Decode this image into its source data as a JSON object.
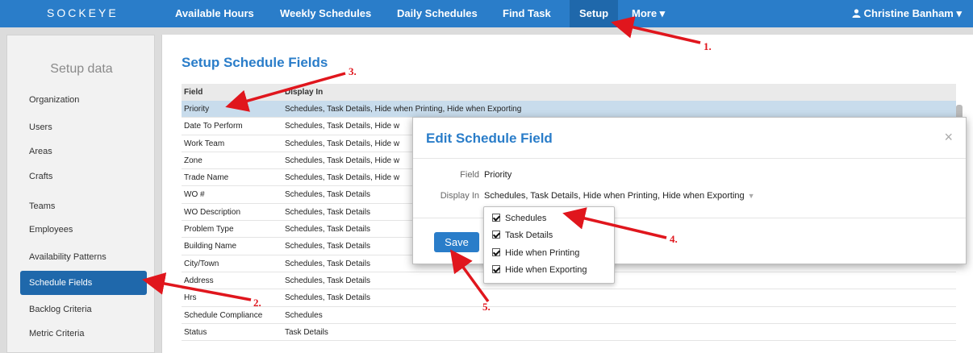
{
  "brand": "SOCKEYE",
  "nav": {
    "items": [
      "Available Hours",
      "Weekly Schedules",
      "Daily Schedules",
      "Find Task",
      "Setup",
      "More ▾"
    ],
    "active": "Setup",
    "user": "Christine Banham ▾",
    "user_icon": "user-icon"
  },
  "sidebar": {
    "title": "Setup data",
    "items": [
      "Organization",
      "Users",
      "Areas",
      "Crafts",
      "Teams",
      "Employees",
      "Availability Patterns",
      "Schedule Fields",
      "Backlog Criteria",
      "Metric Criteria"
    ],
    "active": "Schedule Fields"
  },
  "main": {
    "title": "Setup Schedule Fields",
    "columns": [
      "Field",
      "Display In"
    ],
    "rows": [
      [
        "Priority",
        "Schedules, Task Details, Hide when Printing, Hide when Exporting"
      ],
      [
        "Date To Perform",
        "Schedules, Task Details, Hide w"
      ],
      [
        "Work Team",
        "Schedules, Task Details, Hide w"
      ],
      [
        "Zone",
        "Schedules, Task Details, Hide w"
      ],
      [
        "Trade Name",
        "Schedules, Task Details, Hide w"
      ],
      [
        "WO #",
        "Schedules, Task Details"
      ],
      [
        "WO Description",
        "Schedules, Task Details"
      ],
      [
        "Problem Type",
        "Schedules, Task Details"
      ],
      [
        "Building Name",
        "Schedules, Task Details"
      ],
      [
        "City/Town",
        "Schedules, Task Details"
      ],
      [
        "Address",
        "Schedules, Task Details"
      ],
      [
        "Hrs",
        "Schedules, Task Details"
      ],
      [
        "Schedule Compliance",
        "Schedules"
      ],
      [
        "Status",
        "Task Details"
      ]
    ]
  },
  "modal": {
    "title": "Edit Schedule Field",
    "close": "×",
    "field_label": "Field",
    "field_value": "Priority",
    "display_label": "Display In",
    "display_value": "Schedules, Task Details, Hide when Printing, Hide when Exporting",
    "save": "Save"
  },
  "dropdown": {
    "options": [
      {
        "label": "Schedules",
        "checked": true
      },
      {
        "label": "Task Details",
        "checked": true
      },
      {
        "label": "Hide when Printing",
        "checked": true
      },
      {
        "label": "Hide when Exporting",
        "checked": true
      }
    ]
  },
  "annotations": {
    "color": "#e0161d",
    "labels": [
      "1.",
      "2.",
      "3.",
      "4.",
      "5."
    ]
  },
  "colors": {
    "nav_bg": "#2a7dc9",
    "active": "#1f68ab",
    "row_selected": "#c8dcec"
  }
}
